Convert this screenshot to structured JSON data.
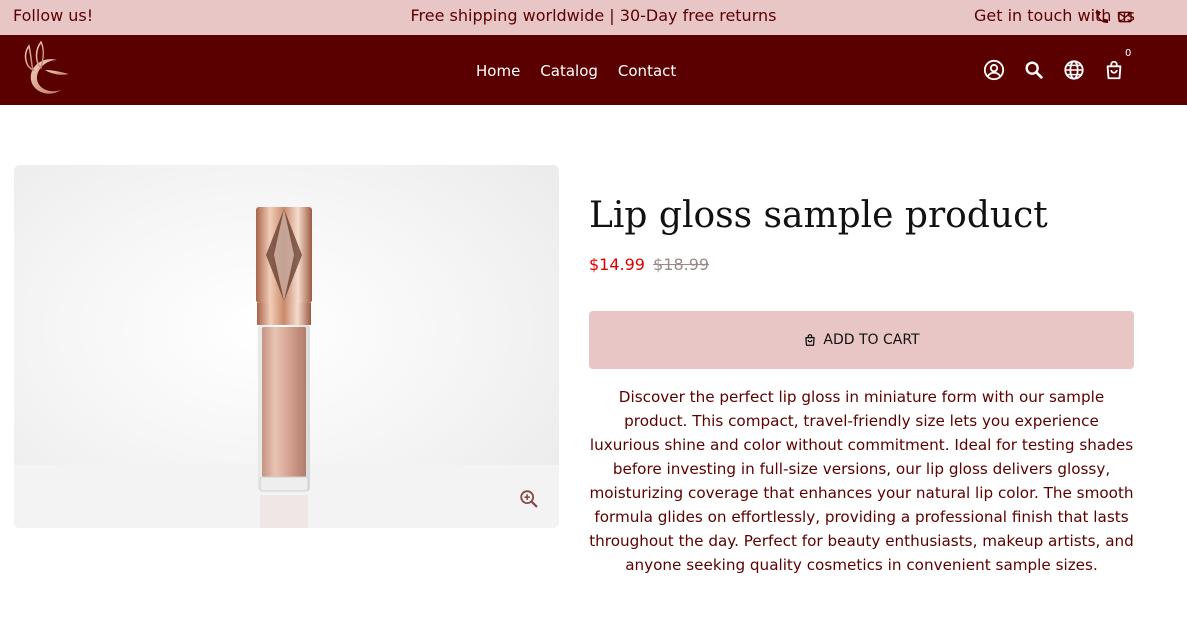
{
  "announcement": {
    "follow": "Follow us!",
    "shipping": "Free shipping worldwide | 30-Day free returns",
    "contact": "Get in touch with us",
    "icons": [
      "phone-icon",
      "mail-icon"
    ]
  },
  "header": {
    "logo": "brand-logo",
    "nav": [
      "Home",
      "Catalog",
      "Contact"
    ],
    "icons": [
      "account-icon",
      "search-icon",
      "globe-icon",
      "cart-icon"
    ],
    "cart_count": "0"
  },
  "product": {
    "title": "Lip gloss sample product",
    "price": "$14.99",
    "compare_price": "$18.99",
    "add_to_cart": "ADD TO CART",
    "description": "Discover the perfect lip gloss in miniature form with our sample product. This compact, travel-friendly size lets you experience luxurious shine and color without commitment. Ideal for testing shades before investing in full-size versions, our lip gloss delivers glossy, moisturizing coverage that enhances your natural lip color. The smooth formula glides on effortlessly, providing a professional finish that lasts throughout the day. Perfect for beauty enthusiasts, makeup artists, and anyone seeking quality cosmetics in convenient sample sizes."
  },
  "colors": {
    "announcement_bg": "#e8c6c6",
    "header_bg": "#5a0000",
    "text": "#5c0000",
    "sale": "#e00000",
    "button_bg": "#e8c6c6"
  }
}
